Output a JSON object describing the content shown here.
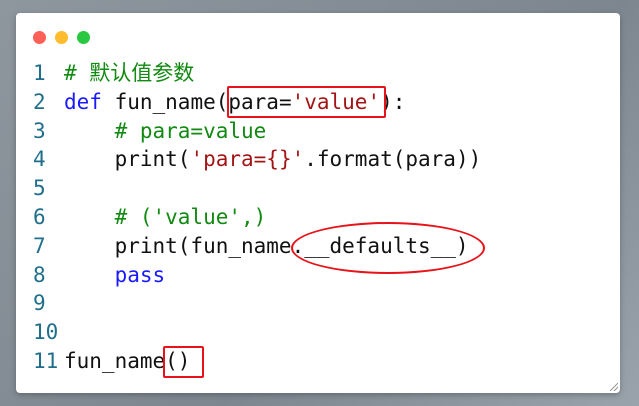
{
  "window": {
    "controls": [
      "close",
      "minimize",
      "maximize"
    ]
  },
  "code": {
    "lines": [
      {
        "number": "1",
        "tokens": [
          {
            "type": "comment",
            "text": "# 默认值参数"
          }
        ]
      },
      {
        "number": "2",
        "tokens": [
          {
            "type": "keyword",
            "text": "def"
          },
          {
            "type": "plain",
            "text": " fun_name("
          },
          {
            "type": "plain",
            "text": "para="
          },
          {
            "type": "string",
            "text": "'value'"
          },
          {
            "type": "plain",
            "text": "):"
          }
        ]
      },
      {
        "number": "3",
        "tokens": [
          {
            "type": "plain",
            "text": "    "
          },
          {
            "type": "comment",
            "text": "# para=value"
          }
        ]
      },
      {
        "number": "4",
        "tokens": [
          {
            "type": "plain",
            "text": "    print("
          },
          {
            "type": "string",
            "text": "'para={}'"
          },
          {
            "type": "plain",
            "text": ".format(para))"
          }
        ]
      },
      {
        "number": "5",
        "tokens": []
      },
      {
        "number": "6",
        "tokens": [
          {
            "type": "plain",
            "text": "    "
          },
          {
            "type": "comment",
            "text": "# ('value',)"
          }
        ]
      },
      {
        "number": "7",
        "tokens": [
          {
            "type": "plain",
            "text": "    print(fun_name.__defaults__)"
          }
        ]
      },
      {
        "number": "8",
        "tokens": [
          {
            "type": "plain",
            "text": "    "
          },
          {
            "type": "keyword",
            "text": "pass"
          }
        ]
      },
      {
        "number": "9",
        "tokens": []
      },
      {
        "number": "10",
        "tokens": []
      },
      {
        "number": "11",
        "tokens": [
          {
            "type": "plain",
            "text": "fun_name()"
          }
        ]
      }
    ]
  },
  "colors": {
    "comment": "#118a11",
    "keyword": "#1a1aff",
    "string": "#a31515",
    "line_number": "#1f6f8b",
    "annotation": "#e8121a"
  }
}
